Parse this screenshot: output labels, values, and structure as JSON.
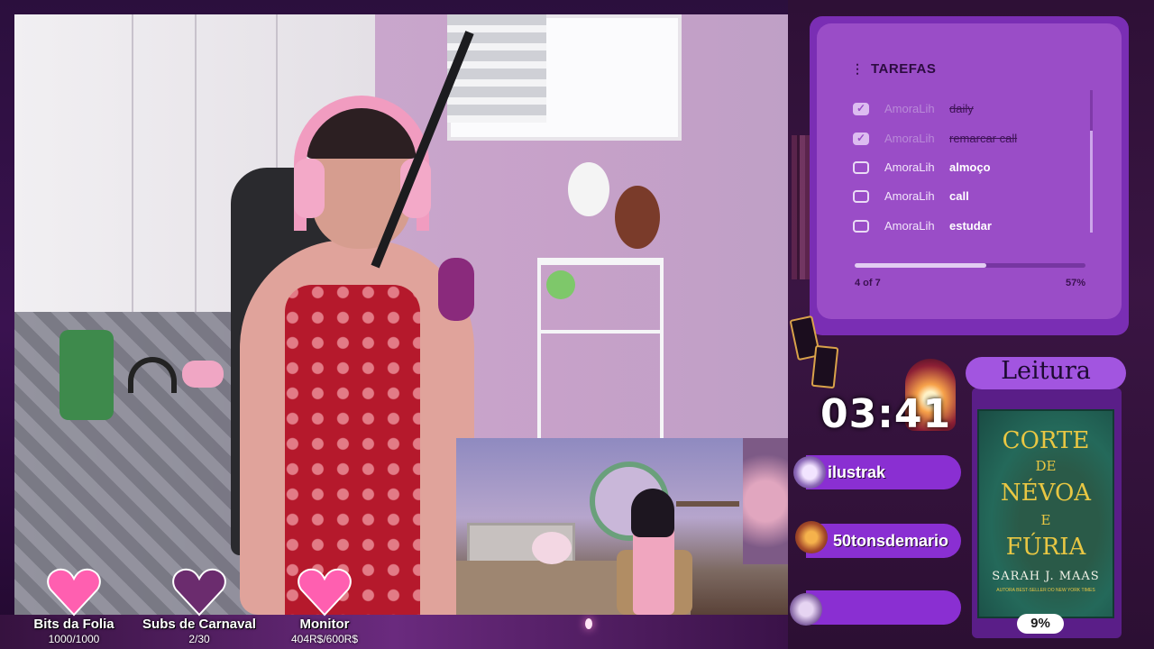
{
  "goals": [
    {
      "title": "Bits da Folia",
      "value": "1000/1000",
      "progress": 1.0
    },
    {
      "title": "Subs de Carnaval",
      "value": "2/30",
      "progress": 0.07
    },
    {
      "title": "Monitor",
      "value": "404R$/600R$",
      "progress": 0.67
    }
  ],
  "tasks": {
    "title": "TAREFAS",
    "items": [
      {
        "user": "AmoraLih",
        "task": "daily",
        "done": true
      },
      {
        "user": "AmoraLih",
        "task": "remarcar call",
        "done": true
      },
      {
        "user": "AmoraLih",
        "task": "almoço",
        "done": false
      },
      {
        "user": "AmoraLih",
        "task": "call",
        "done": false
      },
      {
        "user": "AmoraLih",
        "task": "estudar",
        "done": false
      }
    ],
    "progress_count": "4 of 7",
    "progress_percent": "57%",
    "progress_value": 0.57
  },
  "timer": "03:41",
  "chatters": [
    "ilustrak",
    "50tonsdemario",
    ""
  ],
  "reading": {
    "title": "Leitura",
    "book_lines": [
      "CORTE",
      "DE",
      "NÉVOA",
      "E",
      "FÚRIA"
    ],
    "author": "SARAH J. MAAS",
    "tagline": "AUTORA BEST-SELLER DO NEW YORK TIMES",
    "progress_percent": "9%"
  },
  "colors": {
    "accent": "#9a4dc7",
    "badge": "#8a2fd2",
    "heart": "#ff5fb0"
  }
}
